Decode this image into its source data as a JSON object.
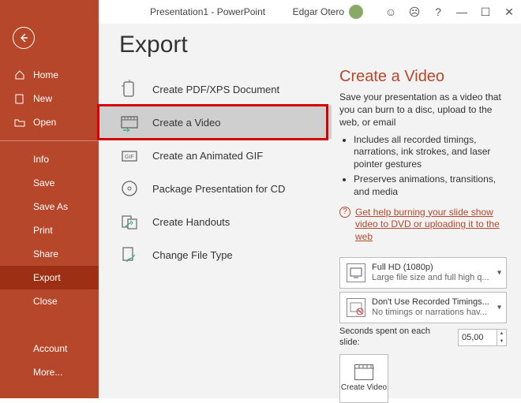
{
  "title": "Presentation1 - PowerPoint",
  "user": "Edgar Otero",
  "sidebar": {
    "home": "Home",
    "new": "New",
    "open": "Open",
    "info": "Info",
    "save": "Save",
    "saveas": "Save As",
    "print": "Print",
    "share": "Share",
    "export": "Export",
    "close": "Close",
    "account": "Account",
    "more": "More..."
  },
  "page_title": "Export",
  "export_list": {
    "pdf": "Create PDF/XPS Document",
    "video": "Create a Video",
    "gif": "Create an Animated GIF",
    "package": "Package Presentation for CD",
    "handouts": "Create Handouts",
    "filetype": "Change File Type"
  },
  "right": {
    "heading": "Create a Video",
    "desc": "Save your presentation as a video that you can burn to a disc, upload to the web, or email",
    "bullet1": "Includes all recorded timings, narrations, ink strokes, and laser pointer gestures",
    "bullet2": "Preserves animations, transitions, and media",
    "help": "Get help burning your slide show video to DVD or uploading it to the web",
    "quality_title": "Full HD (1080p)",
    "quality_sub": "Large file size and full high q...",
    "timing_title": "Don't Use Recorded Timings...",
    "timing_sub": "No timings or narrations hav...",
    "seconds_label": "Seconds spent on each slide:",
    "seconds_value": "05,00",
    "create_btn": "Create Video"
  }
}
